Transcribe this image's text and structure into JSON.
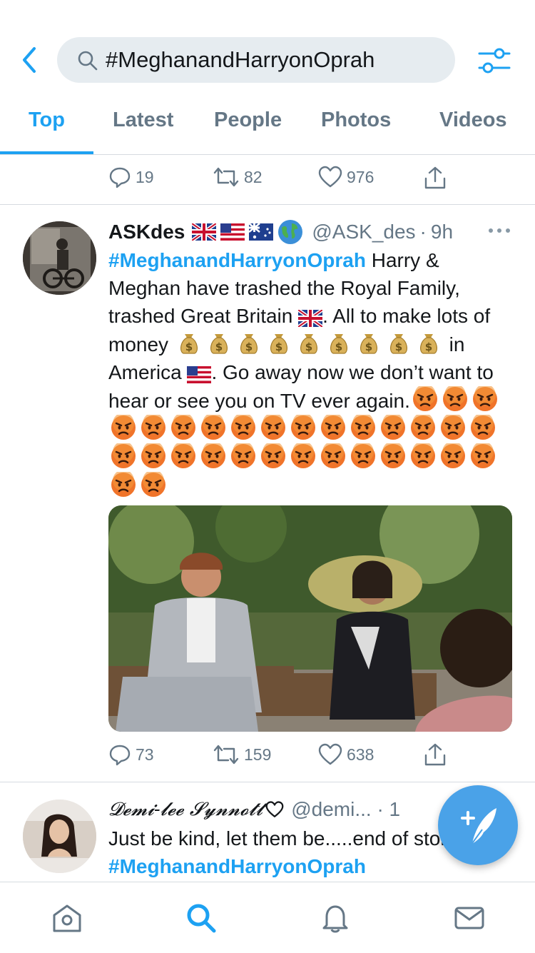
{
  "search": {
    "query": "#MeghanandHarryonOprah"
  },
  "tabs": [
    {
      "label": "Top",
      "active": true
    },
    {
      "label": "Latest"
    },
    {
      "label": "People"
    },
    {
      "label": "Photos"
    },
    {
      "label": "Videos"
    }
  ],
  "prev_tweet": {
    "replies": "19",
    "retweets": "82",
    "likes": "976"
  },
  "tweet1": {
    "name": "ASKdes",
    "flags": [
      "uk-flag",
      "us-flag",
      "australia-flag",
      "globe-emoji"
    ],
    "handle": "@ASK_des",
    "time": "9h",
    "hashtag": "#MeghanandHarryonOprah",
    "text_1": " Harry & Meghan have trashed the Royal Family, trashed Great Britain ",
    "text_2": ". All to make lots of money ",
    "text_3": " in America ",
    "text_4": ". Go away now we don’t want to hear or see you on TV ever again.",
    "money_bag_count": 9,
    "angry_face_count": 31,
    "replies": "73",
    "retweets": "159",
    "likes": "638"
  },
  "tweet2": {
    "name": "𝓓𝓮𝓶𝓲-𝓵𝓮𝓮 𝓢𝔂𝓷𝓷𝓸𝓽𝓽",
    "handle": "@demi... · 1",
    "text_1": "Just be kind, let them be.....end of story",
    "hashtag": "#MeghanandHarryonOprah"
  },
  "colors": {
    "accent": "#1da1f2",
    "muted": "#657786",
    "fab": "#4aa2e8"
  },
  "icons": {
    "nav": [
      "home-icon",
      "search-icon",
      "notifications-icon",
      "messages-icon"
    ],
    "fab": "compose-tweet-icon"
  }
}
